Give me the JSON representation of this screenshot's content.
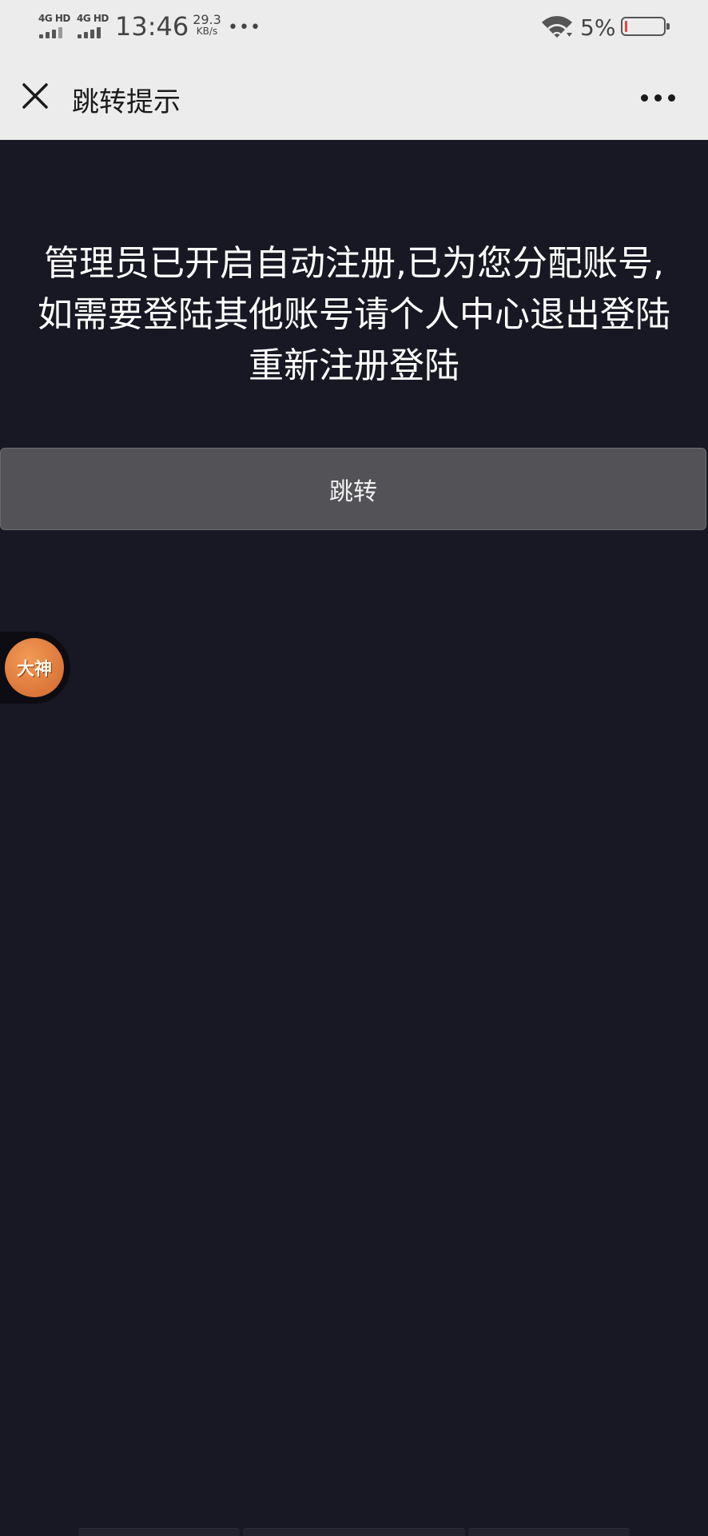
{
  "status_bar": {
    "network1": "4G HD",
    "network2": "4G HD",
    "time": "13:46",
    "speed_value": "29.3",
    "speed_unit": "KB/s",
    "battery_percent": "5%",
    "battery_level": 0.05,
    "battery_low_color": "#e0483e"
  },
  "nav": {
    "title": "跳转提示",
    "close_icon": "close-icon",
    "menu_icon": "more-dots-icon"
  },
  "content": {
    "message": "管理员已开启自动注册,已为您分配账号,如需要登陆其他账号请个人中心退出登陆重新注册登陆",
    "button_label": "跳转"
  },
  "floating_badge": {
    "text": "大神"
  },
  "colors": {
    "background": "#181824",
    "header": "#ececec",
    "button": "#535256"
  }
}
